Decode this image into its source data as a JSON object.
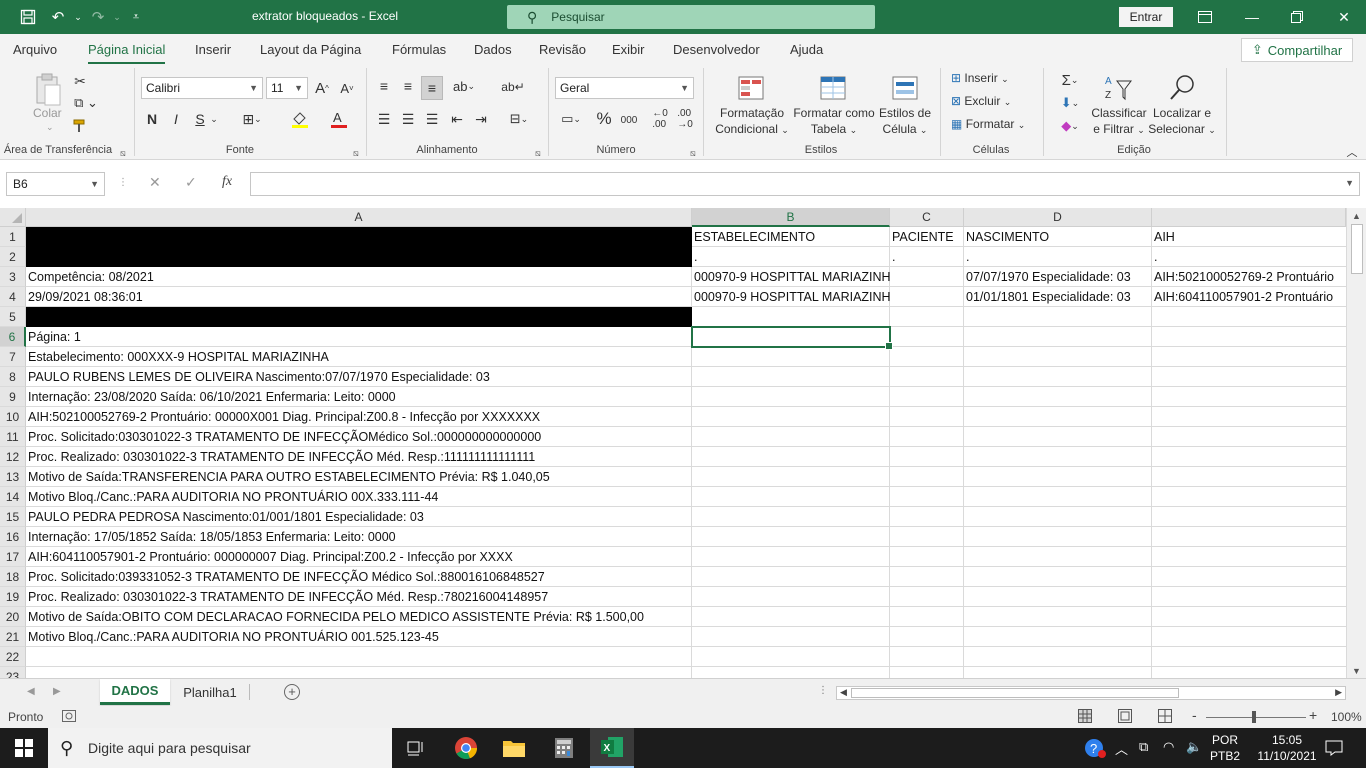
{
  "window": {
    "title": "extrator bloqueados  -  Excel",
    "search_placeholder": "Pesquisar",
    "signin_label": "Entrar"
  },
  "menu": {
    "tabs": [
      "Arquivo",
      "Página Inicial",
      "Inserir",
      "Layout da Página",
      "Fórmulas",
      "Dados",
      "Revisão",
      "Exibir",
      "Desenvolvedor",
      "Ajuda"
    ],
    "active_tab": "Página Inicial",
    "share_label": "Compartilhar"
  },
  "ribbon": {
    "groups": {
      "clipboard": "Área de Transferência",
      "font": "Fonte",
      "alignment": "Alinhamento",
      "number": "Número",
      "styles": "Estilos",
      "cells": "Células",
      "editing": "Edição"
    },
    "paste_label": "Colar",
    "font_name": "Calibri",
    "font_size": "11",
    "bold": "N",
    "italic": "I",
    "underline": "S",
    "number_format": "Geral",
    "cond_format_1": "Formatação",
    "cond_format_2": "Condicional",
    "format_table_1": "Formatar como",
    "format_table_2": "Tabela",
    "cell_styles_1": "Estilos de",
    "cell_styles_2": "Célula",
    "insert_label": "Inserir",
    "delete_label": "Excluir",
    "format_label": "Formatar",
    "sort_1": "Classificar",
    "sort_2": "e Filtrar",
    "find_1": "Localizar e",
    "find_2": "Selecionar",
    "thousands": "000"
  },
  "formula_bar": {
    "name_box": "B6",
    "fx_label": "fx",
    "formula": ""
  },
  "sheet": {
    "columns": [
      "A",
      "B",
      "C",
      "D"
    ],
    "selected_column": "B",
    "rows": [
      "1",
      "2",
      "3",
      "4",
      "5",
      "6",
      "7",
      "8",
      "9",
      "10",
      "11",
      "12",
      "13",
      "14",
      "15",
      "16",
      "17",
      "18",
      "19",
      "20",
      "21",
      "22",
      "23"
    ],
    "selected_row": "6",
    "cells": {
      "B1": "ESTABELECIMENTO",
      "C1": "PACIENTE",
      "D1": "NASCIMENTO",
      "E1": "AIH",
      "B2": ".",
      "C2": ".",
      "D2": ".",
      "E2": ".",
      "A3": "Competência: 08/2021",
      "B3": "000970-9 HOSPITTAL MARIAZINHA",
      "D3": "07/07/1970 Especialidade: 03",
      "E3": "AIH:502100052769-2 Prontuário",
      "A4": "29/09/2021 08:36:01",
      "B4": "000970-9 HOSPITTAL MARIAZINHA",
      "D4": "01/01/1801 Especialidade: 03",
      "E4": "AIH:604110057901-2 Prontuário",
      "A6": "Página: 1",
      "A7": "Estabelecimento: 000XXX-9 HOSPITAL MARIAZINHA",
      "A8": "PAULO  RUBENS LEMES DE OLIVEIRA Nascimento:07/07/1970 Especialidade: 03",
      "A9": "Internação: 23/08/2020 Saída: 06/10/2021 Enfermaria: Leito: 0000",
      "A10": "AIH:502100052769-2 Prontuário: 00000X001 Diag. Principal:Z00.8 - Infecção por XXXXXXX",
      "A11": "Proc. Solicitado:030301022-3 TRATAMENTO DE INFECÇÃOMédico Sol.:000000000000000",
      "A12": "Proc. Realizado: 030301022-3 TRATAMENTO DE INFECÇÃO  Méd. Resp.:111111111111111",
      "A13": "Motivo de Saída:TRANSFERENCIA PARA OUTRO ESTABELECIMENTO Prévia: R$ 1.040,05",
      "A14": "Motivo Bloq./Canc.:PARA AUDITORIA NO PRONTUÁRIO 00X.333.111-44",
      "A15": "PAULO PEDRA PEDROSA Nascimento:01/001/1801 Especialidade: 03",
      "A16": "Internação: 17/05/1852 Saída: 18/05/1853 Enfermaria: Leito: 0000",
      "A17": "AIH:604110057901-2 Prontuário: 000000007 Diag. Principal:Z00.2 - Infecção por XXXX",
      "A18": "Proc. Solicitado:039331052-3 TRATAMENTO DE INFECÇÃO  Médico Sol.:880016106848527",
      "A19": "Proc. Realizado: 030301022-3 TRATAMENTO DE INFECÇÃO  Méd. Resp.:780216004148957",
      "A20": "Motivo de Saída:OBITO COM DECLARACAO FORNECIDA PELO MEDICO ASSISTENTE Prévia: R$ 1.500,00",
      "A21": "Motivo Bloq./Canc.:PARA AUDITORIA NO PRONTUÁRIO 001.525.123-45"
    }
  },
  "sheet_tabs": {
    "tabs": [
      "DADOS",
      "Planilha1"
    ],
    "active": "DADOS"
  },
  "status": {
    "ready": "Pronto",
    "zoom": "100%",
    "zoom_minus": "-",
    "zoom_plus": "+"
  },
  "taskbar": {
    "search_placeholder": "Digite aqui para pesquisar",
    "lang_1": "POR",
    "lang_2": "PTB2",
    "time": "15:05",
    "date": "11/10/2021"
  },
  "colors": {
    "excel_green": "#217346",
    "search_bg": "#9fd5b7",
    "redacted": "#000000"
  }
}
